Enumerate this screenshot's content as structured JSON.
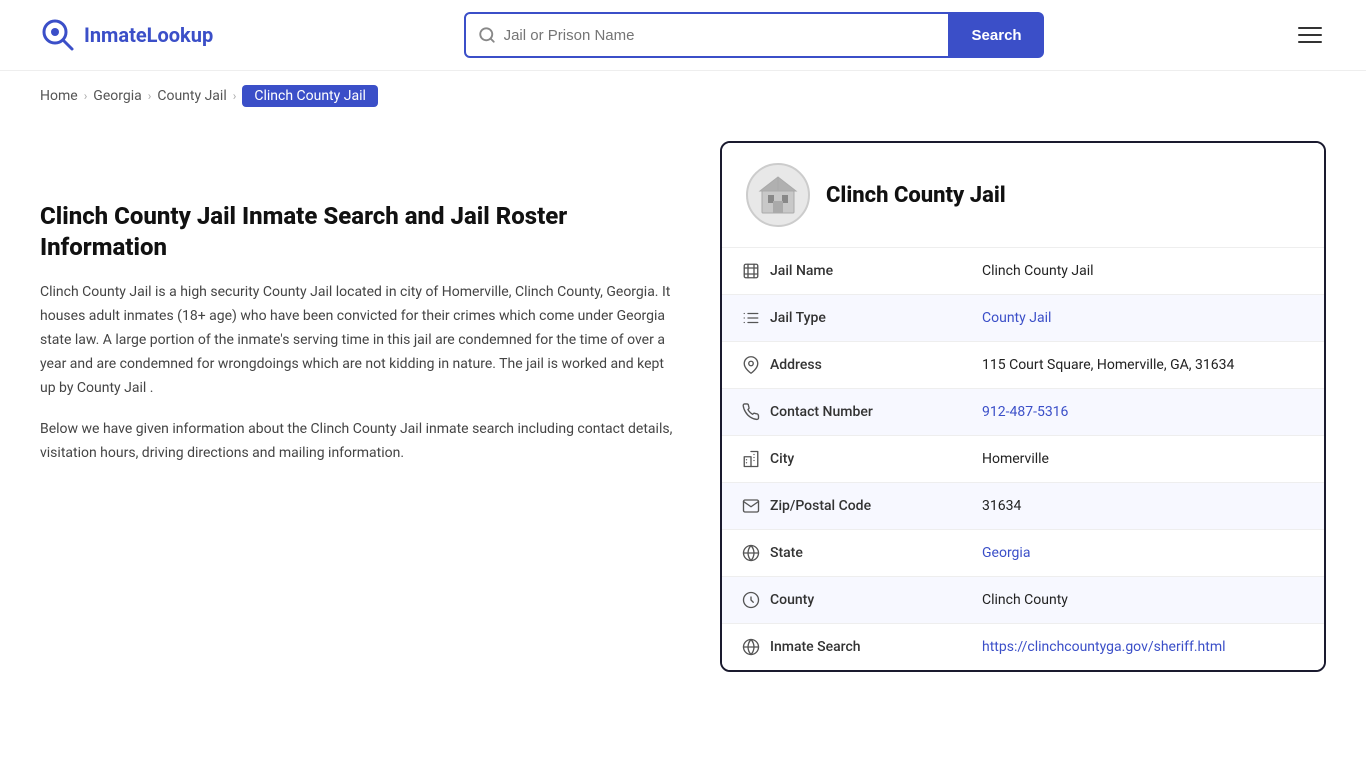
{
  "header": {
    "logo_text_part1": "Inmate",
    "logo_text_part2": "Lookup",
    "search_placeholder": "Jail or Prison Name",
    "search_button_label": "Search"
  },
  "breadcrumb": {
    "items": [
      {
        "label": "Home",
        "href": "#"
      },
      {
        "label": "Georgia",
        "href": "#"
      },
      {
        "label": "County Jail",
        "href": "#"
      },
      {
        "label": "Clinch County Jail",
        "active": true
      }
    ]
  },
  "left": {
    "heading": "Clinch County Jail Inmate Search and Jail Roster Information",
    "description1": "Clinch County Jail is a high security County Jail located in city of Homerville, Clinch County, Georgia. It houses adult inmates (18+ age) who have been convicted for their crimes which come under Georgia state law. A large portion of the inmate's serving time in this jail are condemned for the time of over a year and are condemned for wrongdoings which are not kidding in nature. The jail is worked and kept up by County Jail .",
    "description2": "Below we have given information about the Clinch County Jail inmate search including contact details, visitation hours, driving directions and mailing information."
  },
  "card": {
    "title": "Clinch County Jail",
    "rows": [
      {
        "label": "Jail Name",
        "value": "Clinch County Jail",
        "link": null,
        "icon": "jail-icon"
      },
      {
        "label": "Jail Type",
        "value": "County Jail",
        "link": "#",
        "icon": "list-icon"
      },
      {
        "label": "Address",
        "value": "115 Court Square, Homerville, GA, 31634",
        "link": null,
        "icon": "pin-icon"
      },
      {
        "label": "Contact Number",
        "value": "912-487-5316",
        "link": "tel:912-487-5316",
        "icon": "phone-icon"
      },
      {
        "label": "City",
        "value": "Homerville",
        "link": null,
        "icon": "city-icon"
      },
      {
        "label": "Zip/Postal Code",
        "value": "31634",
        "link": null,
        "icon": "mail-icon"
      },
      {
        "label": "State",
        "value": "Georgia",
        "link": "#",
        "icon": "globe-icon"
      },
      {
        "label": "County",
        "value": "Clinch County",
        "link": null,
        "icon": "county-icon"
      },
      {
        "label": "Inmate Search",
        "value": "https://clinchcountyga.gov/sheriff.html",
        "link": "https://clinchcountyga.gov/sheriff.html",
        "icon": "search-globe-icon"
      }
    ]
  }
}
